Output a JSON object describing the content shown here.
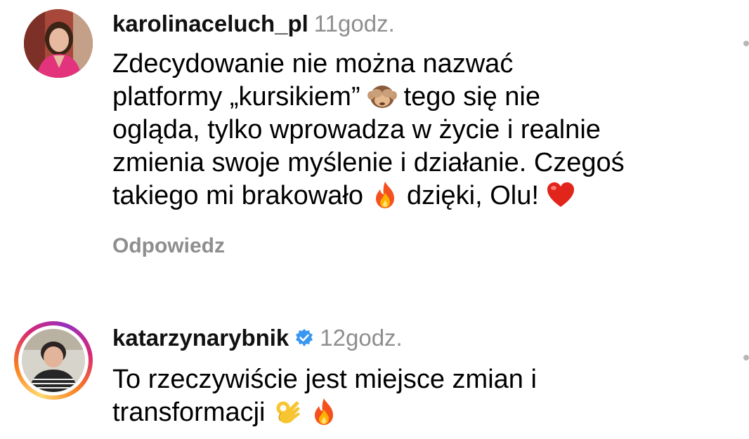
{
  "comments": [
    {
      "username": "karolinaceluch_pl",
      "time": "11godz.",
      "verified": false,
      "lines": [
        {
          "before": "Zdecydowanie nie można nazwać",
          "emoji": null,
          "after": ""
        },
        {
          "before": "platformy „kursikiem”",
          "emoji": "see-no-evil-monkey-icon",
          "after": "tego się nie"
        },
        {
          "before": "ogląda, tylko wprowadza w życie i realnie",
          "emoji": null,
          "after": ""
        },
        {
          "before": "zmienia swoje myślenie i działanie. Czegoś",
          "emoji": null,
          "after": ""
        },
        {
          "before": "takiego mi brakowało",
          "emoji": "fire-icon",
          "after": "dzięki, Olu!"
        }
      ],
      "trailing_emoji": "red-heart-icon",
      "reply_label": "Odpowiedz"
    },
    {
      "username": "katarzynarybnik",
      "time": "12godz.",
      "verified": true,
      "lines": [
        {
          "before": "To rzeczywiście jest miejsce zmian i",
          "emoji": null,
          "after": ""
        },
        {
          "before": "transformacji",
          "emoji": "ok-hand-icon",
          "after": ""
        }
      ],
      "trailing_emoji": "fire-icon"
    }
  ],
  "colors": {
    "username": "#111111",
    "meta_gray": "#8e8e8e",
    "verified_blue": "#3897f0"
  }
}
